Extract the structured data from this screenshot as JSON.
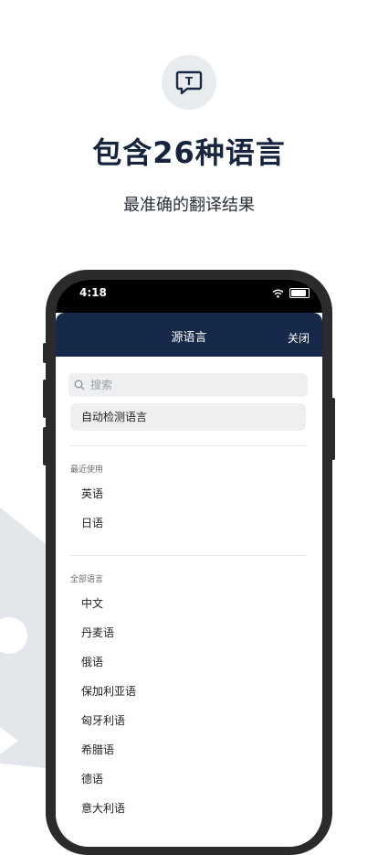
{
  "hero": {
    "icon": "translate-bubble-icon",
    "icon_letter": "T",
    "title": "包含26种语言",
    "subtitle": "最准确的翻译结果"
  },
  "status_bar": {
    "time": "4:18"
  },
  "navbar": {
    "title": "源语言",
    "close_label": "关闭"
  },
  "search": {
    "placeholder": "搜索"
  },
  "auto_detect_label": "自动检测语言",
  "recent": {
    "header": "最近使用",
    "items": [
      "英语",
      "日语"
    ]
  },
  "all": {
    "header": "全部语言",
    "items": [
      "中文",
      "丹麦语",
      "俄语",
      "保加利亚语",
      "匈牙利语",
      "希腊语",
      "德语",
      "意大利语"
    ]
  },
  "colors": {
    "navbar": "#16294a",
    "title": "#16243e",
    "accent": "#1b2a44"
  }
}
